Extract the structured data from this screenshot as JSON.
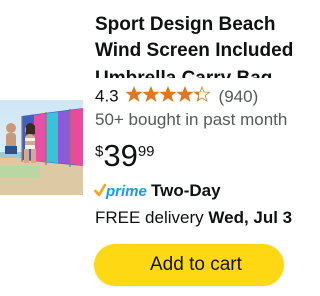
{
  "product": {
    "image_alt": "Product photo: beach wind screen",
    "title_lines": [
      "Sport Design Beach",
      "Wind Screen Included",
      "Umbrella Carry Bag"
    ],
    "rating_value": "4.3",
    "stars_out_of_5": 4.3,
    "review_count": "(940)",
    "bought_text": "50+ bought in past month",
    "price": {
      "symbol": "$",
      "whole": "39",
      "fraction": "99"
    },
    "prime": {
      "logo_text": "prime",
      "days_text": "Two-Day"
    },
    "delivery": {
      "prefix": "FREE delivery ",
      "date": "Wed, Jul 3"
    },
    "add_to_cart_label": "Add to cart"
  },
  "colors": {
    "button": "#ffd814",
    "star": "#de7921",
    "prime_orange": "#f7a21b",
    "prime_blue": "#1399ff",
    "text": "#0f1111",
    "secondary_text": "#565959"
  },
  "icons": {
    "star": "star-icon",
    "prime_check": "prime-check-icon"
  }
}
